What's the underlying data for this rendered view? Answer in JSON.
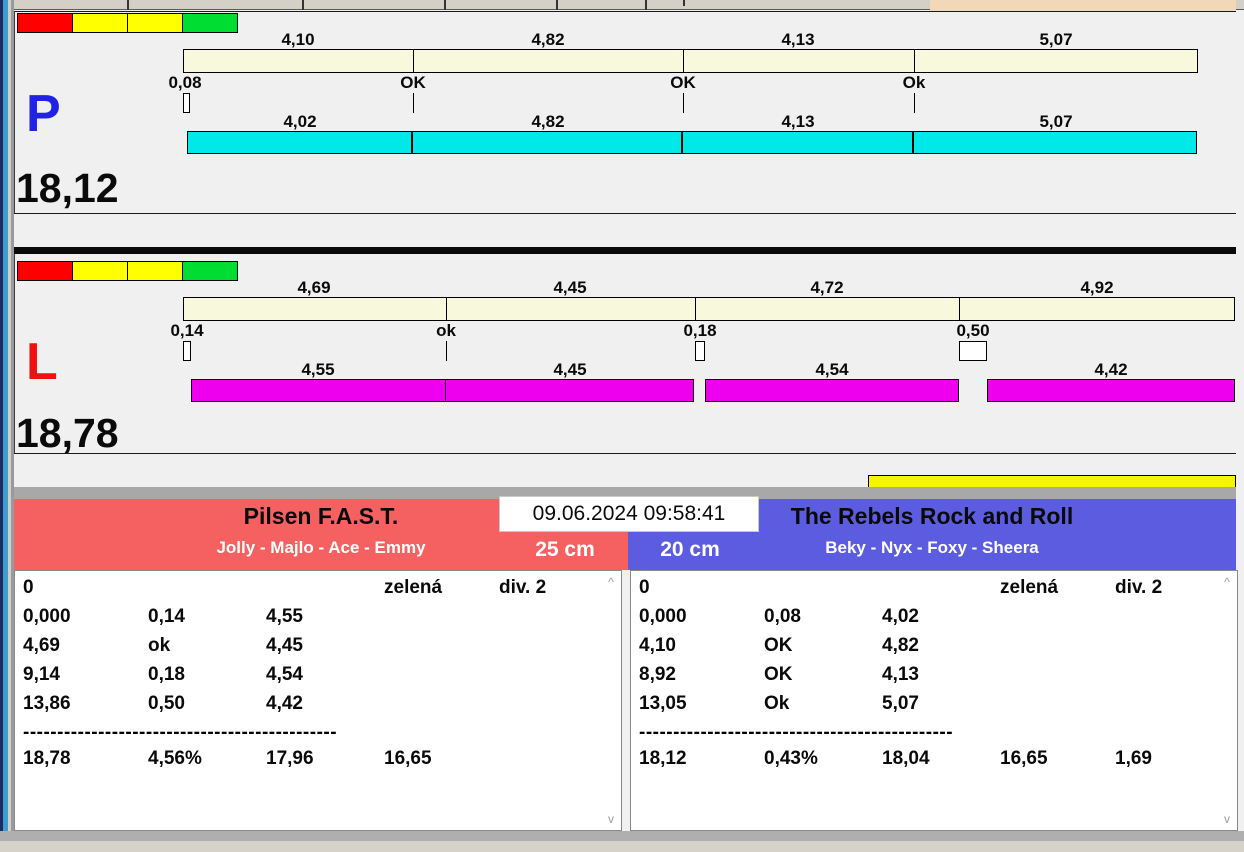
{
  "datetime": "09.06.2024 09:58:41",
  "colors": {
    "status_boxes": [
      "#FF0000",
      "#FFFF00",
      "#FFFF00",
      "#00DD32"
    ],
    "split_bar_fill": "#F8F8DC",
    "lane_p_run_fill": "#00E9E9",
    "lane_l_run_fill": "#EE00EE",
    "team_left_bg": "#F56060",
    "team_right_bg": "#5C5CE0",
    "result_strip_fill": "#F5F500"
  },
  "lanes": [
    {
      "id": "P",
      "letter": "P",
      "letter_color": "#2222E6",
      "total": "18,12",
      "run_fill": "#00E9E9",
      "top_segments": [
        {
          "label": "4,10",
          "value": 4.1
        },
        {
          "label": "4,82",
          "value": 4.82
        },
        {
          "label": "4,13",
          "value": 4.13
        },
        {
          "label": "5,07",
          "value": 5.07
        }
      ],
      "start_marker": {
        "label": "0,08",
        "value": 0.08,
        "type": "box"
      },
      "change_markers": [
        {
          "label": "OK",
          "type": "tick",
          "value": 0
        },
        {
          "label": "OK",
          "type": "tick",
          "value": 0
        },
        {
          "label": "Ok",
          "type": "tick",
          "value": 0
        }
      ],
      "bottom_segments": [
        {
          "label": "4,02",
          "value": 4.02
        },
        {
          "label": "4,82",
          "value": 4.82
        },
        {
          "label": "4,13",
          "value": 4.13
        },
        {
          "label": "5,07",
          "value": 5.07
        }
      ]
    },
    {
      "id": "L",
      "letter": "L",
      "letter_color": "#EE1111",
      "total": "18,78",
      "run_fill": "#EE00EE",
      "top_segments": [
        {
          "label": "4,69",
          "value": 4.69
        },
        {
          "label": "4,45",
          "value": 4.45
        },
        {
          "label": "4,72",
          "value": 4.72
        },
        {
          "label": "4,92",
          "value": 4.92
        }
      ],
      "start_marker": {
        "label": "0,14",
        "value": 0.14,
        "type": "box"
      },
      "change_markers": [
        {
          "label": "ok",
          "type": "tick",
          "value": 0
        },
        {
          "label": "0,18",
          "type": "box",
          "value": 0.18
        },
        {
          "label": "0,50",
          "type": "box",
          "value": 0.5
        }
      ],
      "bottom_segments": [
        {
          "label": "4,55",
          "value": 4.55
        },
        {
          "label": "4,45",
          "value": 4.45
        },
        {
          "label": "4,54",
          "value": 4.54
        },
        {
          "label": "4,42",
          "value": 4.42
        }
      ]
    }
  ],
  "teams": [
    {
      "name": "Pilsen F.A.S.T.",
      "dogs": "Jolly - Majlo - Ace - Emmy",
      "jump_height": "25 cm",
      "bg": "#F56060",
      "table": {
        "penalty": "0",
        "status": "zelená",
        "division": "div. 2",
        "rows": [
          {
            "split": "0,000",
            "change": "0,14",
            "time": "4,55"
          },
          {
            "split": "4,69",
            "change": "ok",
            "time": "4,45"
          },
          {
            "split": "9,14",
            "change": "0,18",
            "time": "4,54"
          },
          {
            "split": "13,86",
            "change": "0,50",
            "time": "4,42"
          }
        ],
        "separator": "----------------------------------------------",
        "totals": [
          "18,78",
          "4,56%",
          "17,96",
          "16,65"
        ]
      }
    },
    {
      "name": "The Rebels Rock and Roll",
      "dogs": "Beky - Nyx - Foxy - Sheera",
      "jump_height": "20 cm",
      "bg": "#5C5CE0",
      "table": {
        "penalty": "0",
        "status": "zelená",
        "division": "div. 2",
        "rows": [
          {
            "split": "0,000",
            "change": "0,08",
            "time": "4,02"
          },
          {
            "split": "4,10",
            "change": "OK",
            "time": "4,82"
          },
          {
            "split": "8,92",
            "change": "OK",
            "time": "4,13"
          },
          {
            "split": "13,05",
            "change": "Ok",
            "time": "5,07"
          }
        ],
        "separator": "----------------------------------------------",
        "totals": [
          "18,12",
          "0,43%",
          "18,04",
          "16,65",
          "1,69"
        ]
      }
    }
  ],
  "scrollbar": {
    "up": "^",
    "down": "v"
  }
}
